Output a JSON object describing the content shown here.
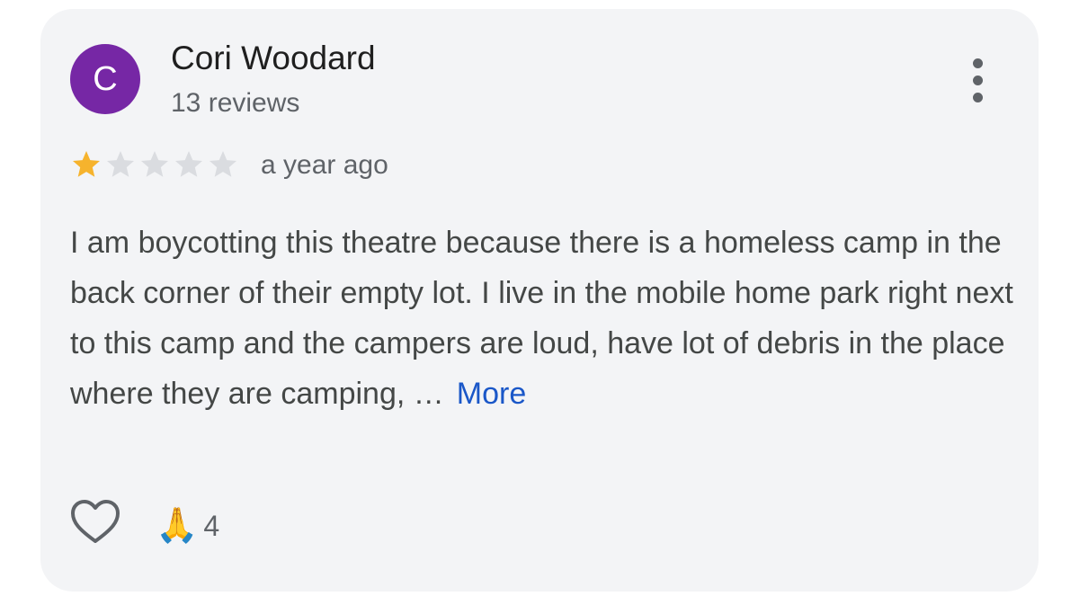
{
  "review": {
    "avatar_letter": "C",
    "avatar_color": "#7627a5",
    "author_name": "Cori Woodard",
    "author_reviews": "13 reviews",
    "rating": 1,
    "rating_max": 5,
    "star_filled_color": "#f6b32d",
    "star_empty_color": "#dadce0",
    "date": "a year ago",
    "text": "I am boycotting this theatre because there is a homeless camp in the back corner of their empty lot. I live in the mobile home park right next to this camp and the campers are loud, have lot of debris in the place where they are camping, …",
    "more_label": "More",
    "more_color": "#1a57c8"
  },
  "actions": {
    "like_icon": "heart-outline-icon",
    "reaction_emoji": "🙏",
    "reaction_count": "4"
  },
  "menu": {
    "icon": "more-vert-icon"
  }
}
